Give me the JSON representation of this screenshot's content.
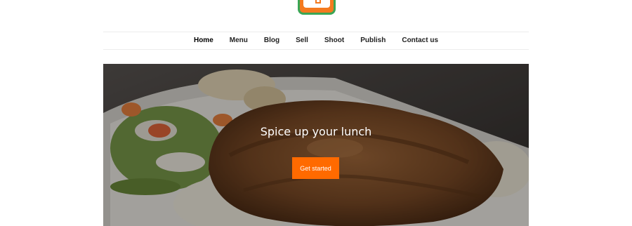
{
  "nav": {
    "items": [
      {
        "label": "Home",
        "active": true
      },
      {
        "label": "Menu"
      },
      {
        "label": "Blog"
      },
      {
        "label": "Sell"
      },
      {
        "label": "Shoot"
      },
      {
        "label": "Publish"
      },
      {
        "label": "Contact us"
      }
    ]
  },
  "hero": {
    "title": "Spice up your lunch",
    "cta_label": "Get started"
  },
  "colors": {
    "accent": "#ff6a00",
    "logo_green": "#3aa655",
    "logo_orange": "#f47a1f"
  }
}
